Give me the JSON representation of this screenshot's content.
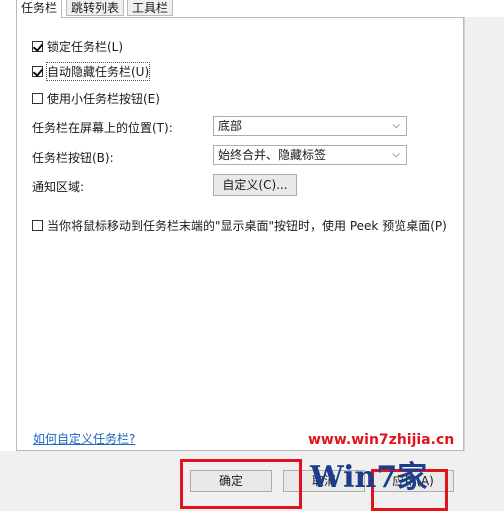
{
  "tabs": [
    {
      "label": "任务栏"
    },
    {
      "label": "跳转列表"
    },
    {
      "label": "工具栏"
    }
  ],
  "options": {
    "lock_taskbar": {
      "label": "锁定任务栏(L)",
      "checked": true
    },
    "auto_hide": {
      "label": "自动隐藏任务栏(U)",
      "checked": true
    },
    "small_buttons": {
      "label": "使用小任务栏按钮(E)",
      "checked": false
    },
    "peek": {
      "label": "当你将鼠标移动到任务栏末端的\"显示桌面\"按钮时，使用 Peek 预览桌面(P)",
      "checked": false
    }
  },
  "position": {
    "label": "任务栏在屏幕上的位置(T):",
    "value": "底部"
  },
  "buttons_mode": {
    "label": "任务栏按钮(B):",
    "value": "始终合并、隐藏标签"
  },
  "notify": {
    "label": "通知区域:",
    "button": "自定义(C)..."
  },
  "help_link": "如何自定义任务栏?",
  "footer": {
    "ok": "确定",
    "cancel": "取消",
    "apply": "应用(A)"
  },
  "watermark": {
    "url": "www.win7zhijia.cn",
    "logo": "Win7",
    "logo_suffix": "家"
  }
}
